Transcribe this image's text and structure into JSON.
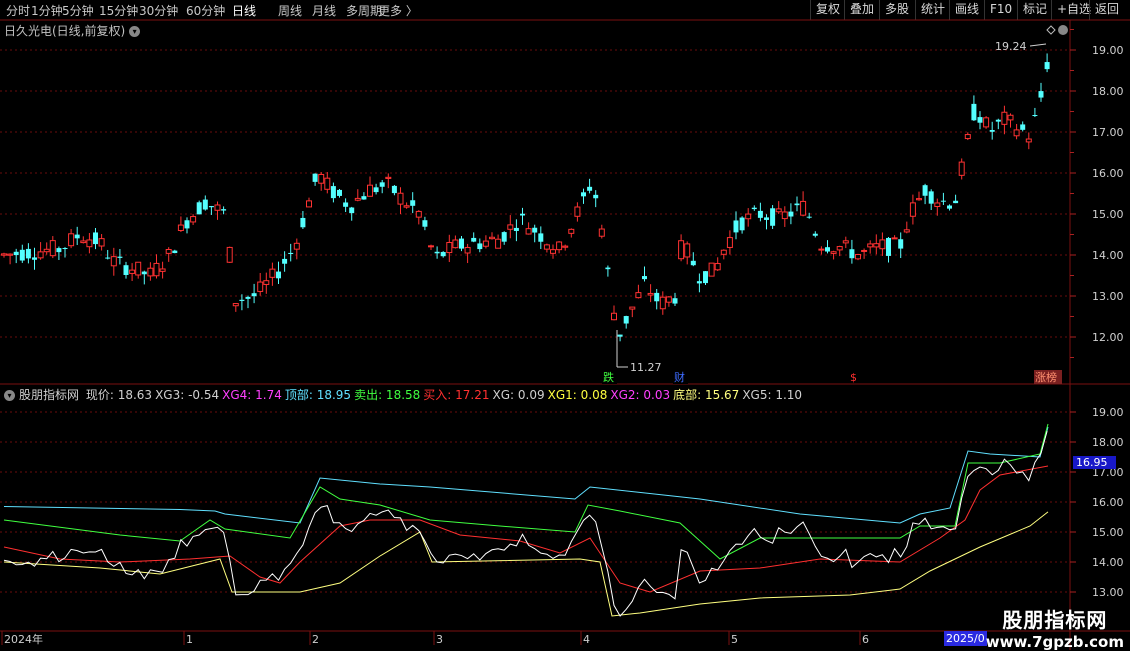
{
  "toolbar": {
    "periods": [
      "分时",
      "1分钟",
      "5分钟",
      "15分钟",
      "30分钟",
      "60分钟",
      "日线",
      "周线",
      "月线",
      "多周期",
      "更多 〉"
    ],
    "active_period": "日线",
    "right_buttons": [
      "复权",
      "叠加",
      "多股",
      "统计",
      "画线",
      "F10",
      "+自选",
      "返回"
    ],
    "right_button_active_label": "标记"
  },
  "main_chart": {
    "title": "日久光电(日线,前复权)",
    "price_labels": [
      "19.00",
      "18.00",
      "17.00",
      "16.00",
      "15.00",
      "14.00",
      "13.00",
      "12.00"
    ],
    "high_label": "19.24",
    "low_label": "11.27",
    "event_tags": [
      "跌",
      "财",
      "$",
      "涨榜"
    ]
  },
  "indicator": {
    "name": "股朋指标网",
    "items": [
      {
        "label": "现价: 18.63",
        "color": "#d0d0d0"
      },
      {
        "label": "XG3: -0.54",
        "color": "#d0d0d0"
      },
      {
        "label": "XG4: 1.74",
        "color": "#ff40ff"
      },
      {
        "label": "顶部: 18.95",
        "color": "#60e0ff"
      },
      {
        "label": "卖出: 18.58",
        "color": "#40ff40"
      },
      {
        "label": "买入: 17.21",
        "color": "#ff3030"
      },
      {
        "label": "XG: 0.09",
        "color": "#d0d0d0"
      },
      {
        "label": "XG1: 0.08",
        "color": "#ffff40"
      },
      {
        "label": "XG2: 0.03",
        "color": "#ff40ff"
      },
      {
        "label": "底部: 15.67",
        "color": "#ffff80"
      },
      {
        "label": "XG5: 1.10",
        "color": "#d0d0d0"
      }
    ],
    "axis_labels": [
      "19.00",
      "18.00",
      "17.00",
      "16.00",
      "15.00",
      "14.00",
      "13.00"
    ],
    "current_value": "16.95"
  },
  "date_axis": {
    "labels": [
      "2024年",
      "1",
      "2",
      "3",
      "4",
      "5",
      "6"
    ],
    "highlight": "2025/0"
  },
  "watermark": {
    "line1": "股朋指标网",
    "line2": "www.7gpzb.com"
  },
  "colors": {
    "up": "#ff3232",
    "down": "#54ffff",
    "grid": "#7a1010",
    "top_line": "#60e0ff",
    "sell_line": "#40ff40",
    "buy_line": "#ff3030",
    "bottom_line": "#ffff80",
    "price_line": "#ffffff"
  },
  "icons": [
    "diamond-icon",
    "chevron-down-icon",
    "settings-circle-icon"
  ]
}
